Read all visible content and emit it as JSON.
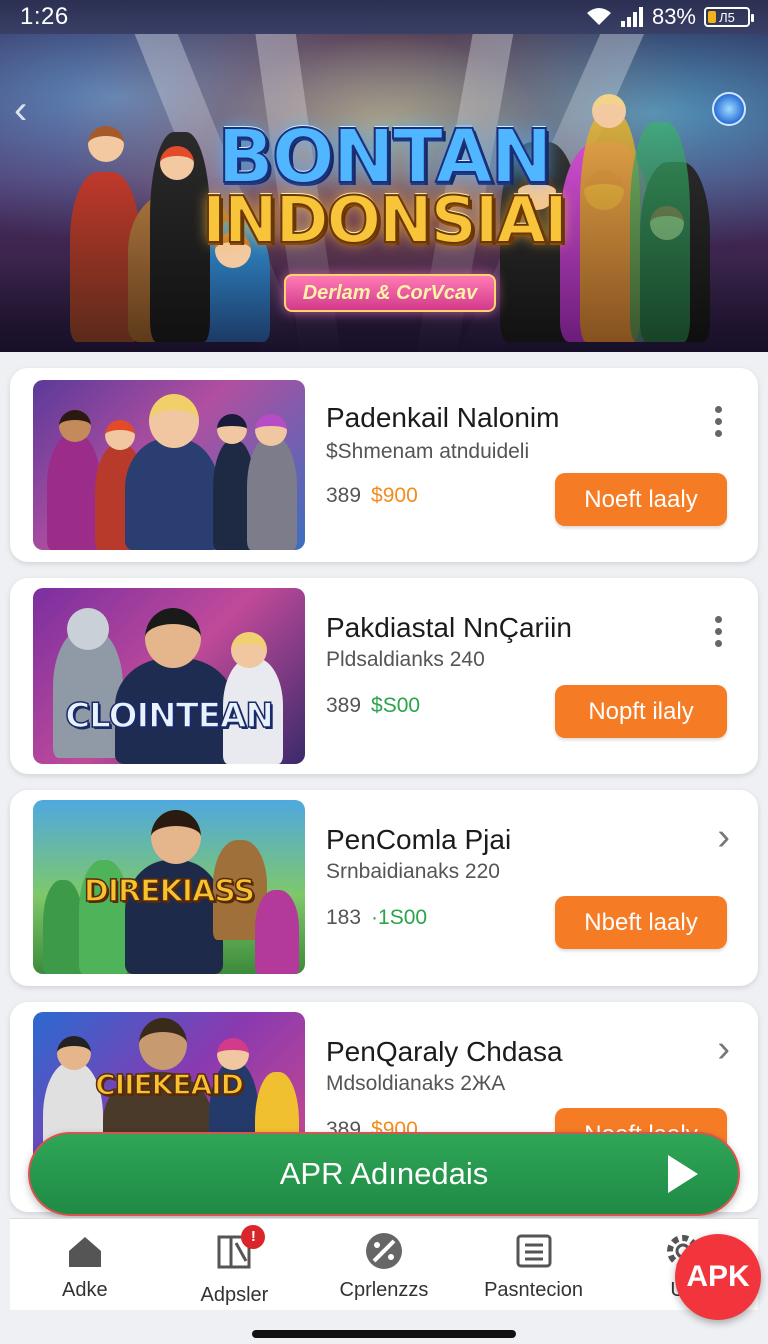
{
  "status_bar": {
    "time": "1:26",
    "battery_pct": "83%",
    "battery_label": "Л5"
  },
  "banner": {
    "title_line1": "BONTAN",
    "title_line2": "INDONSIAI",
    "subtitle": "Derlam & CorVcav"
  },
  "cards": [
    {
      "title": "Padenkail Nalonim",
      "subtitle": "$Shmenam atnduideli",
      "price": "389",
      "price_accent": "$900",
      "accent_color": "#f28c1e",
      "button": "Noeft laaly",
      "trailing": "kebab-icon",
      "thumb_logo": ""
    },
    {
      "title": "Pakdiastal NnÇariin",
      "subtitle": "Pldsaldianks 240",
      "price": "389",
      "price_accent": "$S00",
      "accent_color": "#2aa34a",
      "button": "Nopft ilaly",
      "trailing": "kebab-icon",
      "thumb_logo": "CLOINTEAN"
    },
    {
      "title": "PenComla Pjai",
      "subtitle": "Srnbaidianaks 220",
      "price": "183",
      "price_accent": "·1S00",
      "accent_color": "#2aa34a",
      "button": "Nbeft laaly",
      "trailing": "chevron-right-icon",
      "thumb_logo": "DIREKIASS"
    },
    {
      "title": "PenQaraly Chdasa",
      "subtitle": "Mdsoldianaks 2ЖA",
      "price": "389",
      "price_accent": "$900",
      "accent_color": "#f28c1e",
      "button": "Noeft laaly",
      "trailing": "chevron-right-icon",
      "thumb_logo": "CIIEKEAID"
    }
  ],
  "cta": {
    "label": "APR Adınedais"
  },
  "bottom_nav": [
    {
      "label": "Adke",
      "icon": "home-icon"
    },
    {
      "label": "Adpsler",
      "icon": "book-icon",
      "badge": "!"
    },
    {
      "label": "Cprlenzzs",
      "icon": "discount-icon"
    },
    {
      "label": "Pasntecion",
      "icon": "list-icon"
    },
    {
      "label": "Un",
      "icon": "gear-icon"
    }
  ],
  "fab": {
    "label": "APK"
  }
}
